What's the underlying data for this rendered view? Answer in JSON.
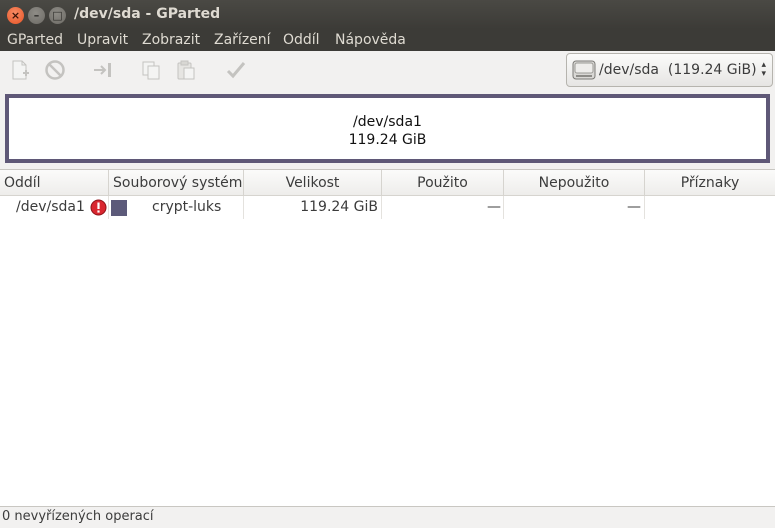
{
  "window": {
    "title": "/dev/sda - GParted",
    "controls": {
      "close": "×",
      "minimize": "–",
      "maximize": "□"
    }
  },
  "menu": [
    "GParted",
    "Upravit",
    "Zobrazit",
    "Zařízení",
    "Oddíl",
    "Nápověda"
  ],
  "toolbar": {
    "icons": [
      "new-partition-icon",
      "delete-partition-icon",
      "resize-move-icon",
      "copy-icon",
      "paste-icon",
      "apply-icon"
    ],
    "device_selector": {
      "value": "/dev/sda  (119.24 GiB)",
      "icon": "hard-disk-icon"
    }
  },
  "disk_map": {
    "partition": "/dev/sda1",
    "size": "119.24 GiB",
    "border_color": "#5f5877"
  },
  "table": {
    "headers": [
      "Oddíl",
      "Souborový systém",
      "Velikost",
      "Použito",
      "Nepoužito",
      "Příznaky"
    ],
    "rows": [
      {
        "partition": "/dev/sda1",
        "warning_icon": "error-icon",
        "filesystem_color": "#5c5a7a",
        "filesystem": "crypt-luks",
        "size": "119.24 GiB",
        "used": "—",
        "unused": "—",
        "flags": ""
      }
    ]
  },
  "status_bar": {
    "text": "0 nevyřízených operací"
  }
}
